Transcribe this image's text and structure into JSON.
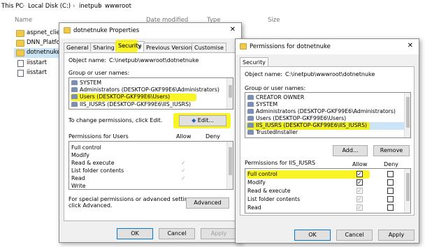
{
  "explorer": {
    "breadcrumb": [
      "This PC",
      "Local Disk (C:)",
      "inetpub",
      "wwwroot"
    ],
    "columns": [
      "Name",
      "Date modified",
      "Type",
      "Size"
    ],
    "files": [
      {
        "name": "aspnet_clien",
        "kind": "folder"
      },
      {
        "name": "DNN_Platfor",
        "kind": "folder"
      },
      {
        "name": "dotnetnuke",
        "kind": "folder",
        "selected": true
      },
      {
        "name": "iisstart",
        "kind": "file"
      },
      {
        "name": "iisstart",
        "kind": "file"
      }
    ]
  },
  "props": {
    "title": "dotnetnuke Properties",
    "tabs": [
      "General",
      "Sharing",
      "Security",
      "Previous Versions",
      "Customise"
    ],
    "object_label": "Object name:",
    "object_value": "C:\\inetpub\\wwwroot\\dotnetnuke",
    "group_label": "Group or user names:",
    "users": [
      "SYSTEM",
      "Administrators (DESKTOP-GKF99E6\\Administrators)",
      "Users (DESKTOP-GKF99E6\\Users)",
      "IIS_IUSRS (DESKTOP-GKF99E6\\IIS_IUSRS)"
    ],
    "change_text": "To change permissions, click Edit.",
    "edit_label": "Edit...",
    "perm_header": "Permissions for Users",
    "allow": "Allow",
    "deny": "Deny",
    "permissions": [
      "Full control",
      "Modify",
      "Read & execute",
      "List folder contents",
      "Read",
      "Write"
    ],
    "special_text_1": "For special permissions or advanced settings,",
    "special_text_2": "click Advanced.",
    "advanced_label": "Advanced",
    "ok": "OK",
    "cancel": "Cancel",
    "apply": "Apply"
  },
  "perm": {
    "title": "Permissions for dotnetnuke",
    "tab": "Security",
    "object_label": "Object name:",
    "object_value": "C:\\inetpub\\wwwroot\\dotnetnuke",
    "group_label": "Group or user names:",
    "users": [
      "CREATOR OWNER",
      "SYSTEM",
      "Administrators (DESKTOP-GKF99E6\\Administrators)",
      "Users (DESKTOP-GKF99E6\\Users)",
      "IIS_IUSRS (DESKTOP-GKF99E6\\IIS_IUSRS)",
      "TrustedInstaller"
    ],
    "add_label": "Add...",
    "remove_label": "Remove",
    "perm_header": "Permissions for IIS_IUSRS",
    "allow": "Allow",
    "deny": "Deny",
    "permissions": [
      "Full control",
      "Modify",
      "Read & execute",
      "List folder contents",
      "Read"
    ],
    "ok": "OK",
    "cancel": "Cancel",
    "apply": "Apply"
  },
  "colors": {
    "highlight": "#f7f200",
    "folder": "#f0c84a",
    "selection": "#cde6f7",
    "accent": "#0078d7"
  }
}
